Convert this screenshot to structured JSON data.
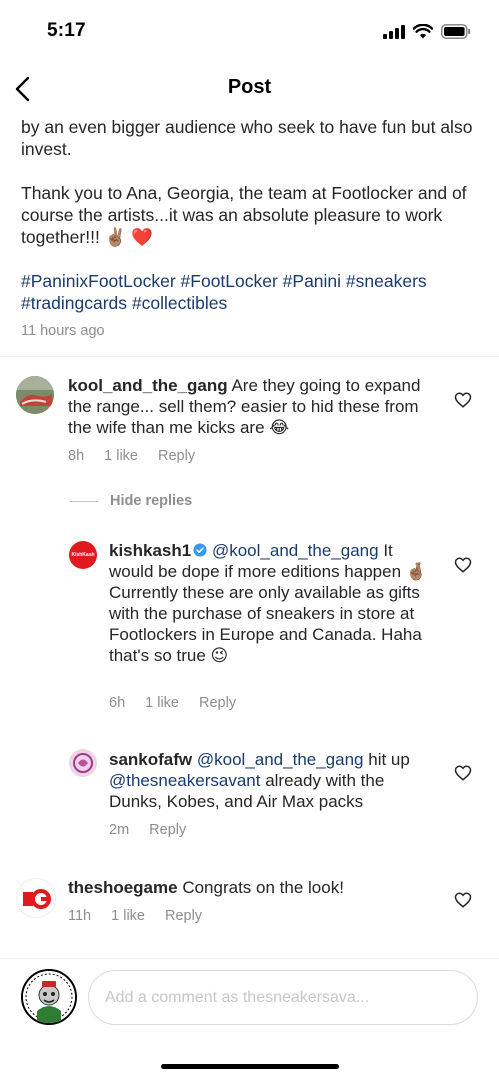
{
  "status": {
    "time": "5:17"
  },
  "nav": {
    "title": "Post"
  },
  "post": {
    "caption_1": "by an even bigger audience who seek to have fun but also invest.",
    "caption_2": "Thank you to Ana, Georgia, the team at Footlocker and of course the artists...it was an absolute pleasure to work together!!! ✌🏽 ❤️",
    "hashtags": "#PaninixFootLocker #FootLocker #Panini #sneakers #tradingcards #collectibles",
    "time": "11 hours ago"
  },
  "comments": [
    {
      "username": "kool_and_the_gang",
      "text": "Are they going to expand the range... sell them? easier to hid these from the wife than me kicks are 😂",
      "time": "8h",
      "likes": "1 like",
      "reply_label": "Reply"
    },
    {
      "username": "theshoegame",
      "text": "Congrats on the look!",
      "time": "11h",
      "likes": "1 like",
      "reply_label": "Reply"
    }
  ],
  "hide_replies_label": "Hide replies",
  "replies": [
    {
      "username": "kishkash1",
      "verified": true,
      "mention": "@kool_and_the_gang",
      "text": "It would be dope if more editions happen 🤞🏽 Currently these are only available as gifts with the purchase of sneakers in store at Footlockers in Europe and Canada. Haha that's so true 😉",
      "time": "6h",
      "likes": "1 like",
      "reply_label": "Reply",
      "avatar_text": "KishKash"
    },
    {
      "username": "sankofafw",
      "mention_1": "@kool_and_the_gang",
      "text_1": "hit up",
      "mention_2": "@thesneakersavant",
      "text_2": "already with the Dunks, Kobes, and Air Max packs",
      "time": "2m",
      "reply_label": "Reply"
    }
  ],
  "composer": {
    "placeholder": "Add a comment as thesneakersava..."
  },
  "icons": {
    "back": "chevron-left-icon",
    "heart": "heart-outline-icon",
    "verified": "verified-badge-icon"
  },
  "colors": {
    "link": "#1b3b6f",
    "muted": "#8e8e8e",
    "verified": "#3897f0",
    "kishkash_red": "#e0191f"
  }
}
